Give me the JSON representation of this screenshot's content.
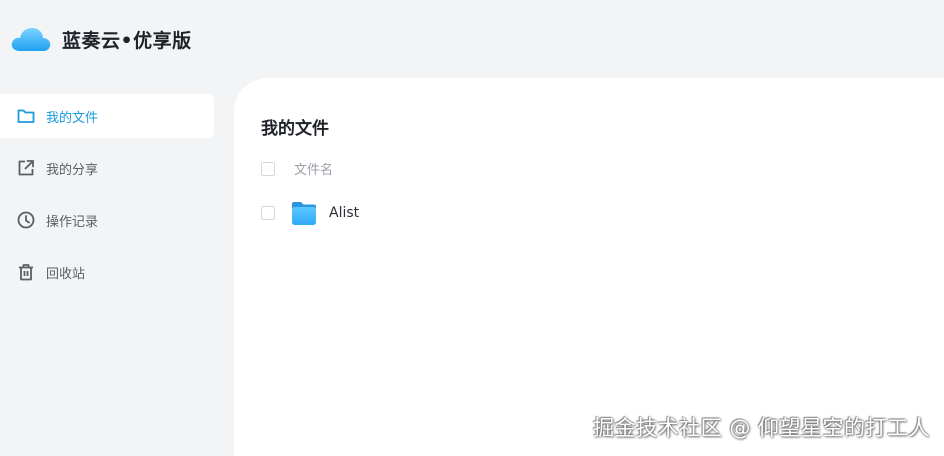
{
  "header": {
    "brand": "蓝奏云•优享版",
    "logo_icon": "cloud-logo-icon"
  },
  "sidebar": {
    "items": [
      {
        "label": "我的文件",
        "icon": "folder-icon",
        "active": true
      },
      {
        "label": "我的分享",
        "icon": "share-icon",
        "active": false
      },
      {
        "label": "操作记录",
        "icon": "clock-icon",
        "active": false
      },
      {
        "label": "回收站",
        "icon": "trash-icon",
        "active": false
      }
    ]
  },
  "main": {
    "title": "我的文件",
    "column_header": "文件名",
    "files": [
      {
        "name": "Alist",
        "icon": "folder-icon"
      }
    ]
  },
  "watermark": "掘金技术社区 @ 仰望星空的打工人",
  "colors": {
    "accent": "#1a9bdc",
    "sidebar_bg": "#f3f4f6",
    "panel_bg": "#ffffff"
  }
}
